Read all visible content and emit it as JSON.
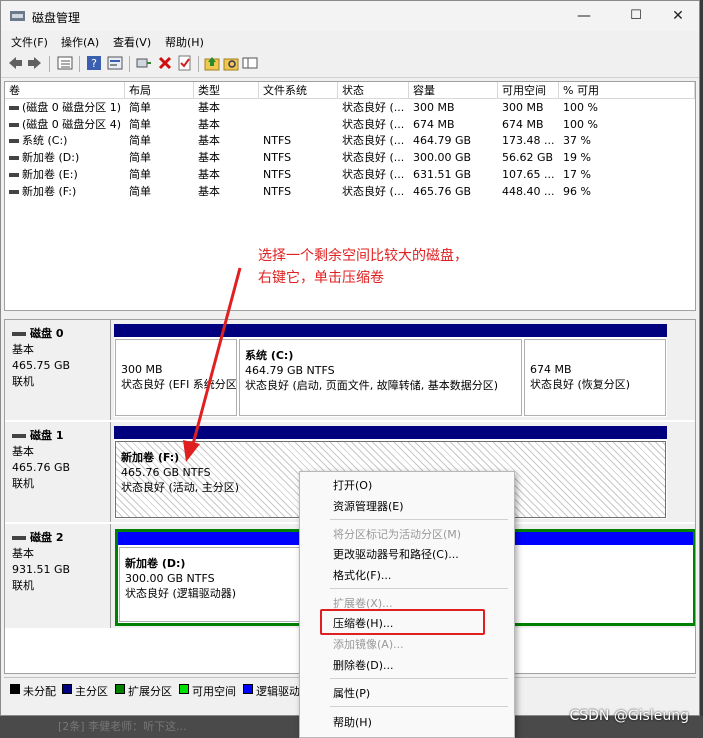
{
  "window": {
    "title": "磁盘管理",
    "controls": [
      "—",
      "☐",
      "✕"
    ]
  },
  "menu": [
    "文件(F)",
    "操作(A)",
    "查看(V)",
    "帮助(H)"
  ],
  "toolbar_icons": [
    "back-icon",
    "forward-icon",
    "list-view-icon",
    "help-icon",
    "properties-icon",
    "connect-icon",
    "delete-icon",
    "check-icon",
    "folder-up-icon",
    "folder-search-icon",
    "view-icon"
  ],
  "volume_table": {
    "headers": [
      "卷",
      "布局",
      "类型",
      "文件系统",
      "状态",
      "容量",
      "可用空间",
      "% 可用"
    ],
    "rows": [
      [
        "(磁盘 0 磁盘分区 1)",
        "简单",
        "基本",
        "",
        "状态良好 (...",
        "300 MB",
        "300 MB",
        "100 %"
      ],
      [
        "(磁盘 0 磁盘分区 4)",
        "简单",
        "基本",
        "",
        "状态良好 (...",
        "674 MB",
        "674 MB",
        "100 %"
      ],
      [
        "系统 (C:)",
        "简单",
        "基本",
        "NTFS",
        "状态良好 (...",
        "464.79 GB",
        "173.48 ...",
        "37 %"
      ],
      [
        "新加卷 (D:)",
        "简单",
        "基本",
        "NTFS",
        "状态良好 (...",
        "300.00 GB",
        "56.62 GB",
        "19 %"
      ],
      [
        "新加卷 (E:)",
        "简单",
        "基本",
        "NTFS",
        "状态良好 (...",
        "631.51 GB",
        "107.65 ...",
        "17 %"
      ],
      [
        "新加卷 (F:)",
        "简单",
        "基本",
        "NTFS",
        "状态良好 (...",
        "465.76 GB",
        "448.40 ...",
        "96 %"
      ]
    ]
  },
  "annotation": {
    "line1": "选择一个剩余空间比较大的磁盘，",
    "line2": "右键它，单击压缩卷"
  },
  "disks": [
    {
      "name": "磁盘 0",
      "type": "基本",
      "size": "465.75 GB",
      "status": "联机",
      "partitions": [
        {
          "title": "",
          "size": "300 MB",
          "status": "状态良好 (EFI 系统分区)"
        },
        {
          "title": "系统  (C:)",
          "size": "464.79 GB NTFS",
          "status": "状态良好 (启动, 页面文件, 故障转储, 基本数据分区)"
        },
        {
          "title": "",
          "size": "674 MB",
          "status": "状态良好 (恢复分区)"
        }
      ]
    },
    {
      "name": "磁盘 1",
      "type": "基本",
      "size": "465.76 GB",
      "status": "联机",
      "partitions": [
        {
          "title": "新加卷  (F:)",
          "size": "465.76 GB NTFS",
          "status": "状态良好 (活动, 主分区)"
        }
      ]
    },
    {
      "name": "磁盘 2",
      "type": "基本",
      "size": "931.51 GB",
      "status": "联机",
      "partitions": [
        {
          "title": "新加卷  (D:)",
          "size": "300.00 GB NTFS",
          "status": "状态良好 (逻辑驱动器)"
        }
      ]
    }
  ],
  "legend": [
    {
      "label": "未分配",
      "color": "#000000"
    },
    {
      "label": "主分区",
      "color": "#00007f"
    },
    {
      "label": "扩展分区",
      "color": "#008000"
    },
    {
      "label": "可用空间",
      "color": "#00e000"
    },
    {
      "label": "逻辑驱动",
      "color": "#0000ff"
    }
  ],
  "context_menu": {
    "open": "打开(O)",
    "explorer": "资源管理器(E)",
    "mark_active": "将分区标记为活动分区(M)",
    "change_letter": "更改驱动器号和路径(C)...",
    "format": "格式化(F)...",
    "extend": "扩展卷(X)...",
    "shrink": "压缩卷(H)...",
    "add_mirror": "添加镜像(A)...",
    "delete": "删除卷(D)...",
    "properties": "属性(P)",
    "help": "帮助(H)"
  },
  "taskbar": {
    "text": "[2条] 李健老师：听下这..."
  },
  "watermark": "CSDN @Gisleung",
  "colors": {
    "primary_partition": "#00007f",
    "logical_drive": "#0000ff",
    "extended_partition": "#008000",
    "annotation": "#e02020"
  }
}
